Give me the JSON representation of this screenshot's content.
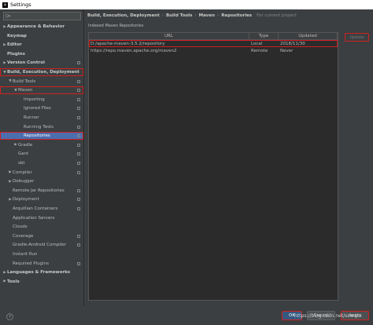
{
  "window": {
    "title": "Settings",
    "icon_label": "IJ"
  },
  "sidebar": {
    "search_placeholder": "Q▾",
    "items": [
      {
        "label": "Appearance & Behavior",
        "arrow": "▶",
        "indent": 0,
        "bold": true
      },
      {
        "label": "Keymap",
        "arrow": "",
        "indent": 0,
        "bold": true
      },
      {
        "label": "Editor",
        "arrow": "▶",
        "indent": 0,
        "bold": true
      },
      {
        "label": "Plugins",
        "arrow": "",
        "indent": 0,
        "bold": true
      },
      {
        "label": "Version Control",
        "arrow": "▶",
        "indent": 0,
        "bold": true,
        "project": true
      },
      {
        "label": "Build, Execution, Deployment",
        "arrow": "▼",
        "indent": 0,
        "bold": true,
        "highlight": true
      },
      {
        "label": "Build Tools",
        "arrow": "▼",
        "indent": 1,
        "project": true
      },
      {
        "label": "Maven",
        "arrow": "▼",
        "indent": 2,
        "project": true,
        "highlight": true
      },
      {
        "label": "Importing",
        "arrow": "",
        "indent": 3,
        "project": true
      },
      {
        "label": "Ignored Files",
        "arrow": "",
        "indent": 3,
        "project": true
      },
      {
        "label": "Runner",
        "arrow": "",
        "indent": 3,
        "project": true
      },
      {
        "label": "Running Tests",
        "arrow": "",
        "indent": 3,
        "project": true
      },
      {
        "label": "Repositories",
        "arrow": "",
        "indent": 3,
        "project": true,
        "selected": true,
        "highlight": true
      },
      {
        "label": "Gradle",
        "arrow": "▶",
        "indent": 2,
        "project": true
      },
      {
        "label": "Gant",
        "arrow": "",
        "indent": 2,
        "project": true
      },
      {
        "label": "sbt",
        "arrow": "",
        "indent": 2,
        "project": true
      },
      {
        "label": "Compiler",
        "arrow": "▶",
        "indent": 1,
        "project": true
      },
      {
        "label": "Debugger",
        "arrow": "▶",
        "indent": 1
      },
      {
        "label": "Remote Jar Repositories",
        "arrow": "",
        "indent": 1,
        "project": true
      },
      {
        "label": "Deployment",
        "arrow": "▶",
        "indent": 1,
        "project": true
      },
      {
        "label": "Arquillian Containers",
        "arrow": "",
        "indent": 1,
        "project": true
      },
      {
        "label": "Application Servers",
        "arrow": "",
        "indent": 1
      },
      {
        "label": "Clouds",
        "arrow": "",
        "indent": 1
      },
      {
        "label": "Coverage",
        "arrow": "",
        "indent": 1,
        "project": true
      },
      {
        "label": "Gradle-Android Compiler",
        "arrow": "",
        "indent": 1,
        "project": true
      },
      {
        "label": "Instant Run",
        "arrow": "",
        "indent": 1
      },
      {
        "label": "Required Plugins",
        "arrow": "",
        "indent": 1,
        "project": true
      },
      {
        "label": "Languages & Frameworks",
        "arrow": "▶",
        "indent": 0,
        "bold": true
      },
      {
        "label": "Tools",
        "arrow": "▶",
        "indent": 0,
        "bold": true
      }
    ]
  },
  "breadcrumb": {
    "parts": [
      "Build, Execution, Deployment",
      "Build Tools",
      "Maven",
      "Repositories"
    ],
    "separator": "›",
    "scope": "For current project"
  },
  "content": {
    "section_label": "Indexed Maven Repositories",
    "columns": [
      "URL",
      "Type",
      "Updated"
    ],
    "rows": [
      {
        "url": "D:/apache-maven-3.5.2/repository",
        "type": "Local",
        "updated": "2018/11/30"
      },
      {
        "url": "https://repo.maven.apache.org/maven2",
        "type": "Remote",
        "updated": "Never"
      }
    ],
    "update_button": "Update"
  },
  "footer": {
    "help": "?",
    "ok": "OK",
    "cancel": "Cancel",
    "apply": "Apply",
    "watermark": "https://blog.csdn.net/sswqzx"
  },
  "colors": {
    "background": "#3c3f41",
    "selection": "#4b6eaf",
    "annotation_red": "#d02020"
  }
}
